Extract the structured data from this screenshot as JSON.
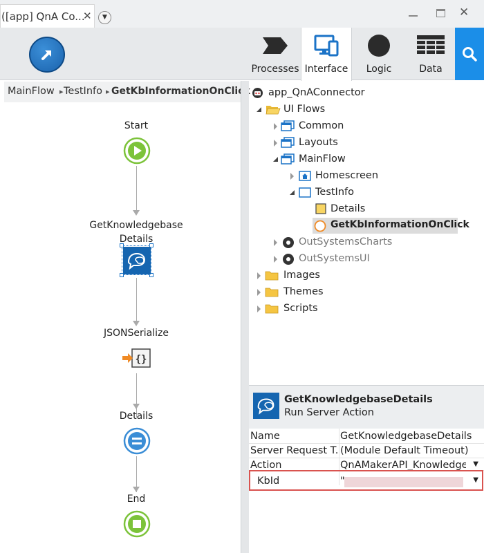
{
  "window": {
    "tab_title": "([app] QnA Co...",
    "tab_close": "✕",
    "dropdown_glyph": "▼",
    "close_glyph": "✕"
  },
  "toolbar": {
    "items": [
      {
        "label": "Processes",
        "icon": "processes-icon"
      },
      {
        "label": "Interface",
        "icon": "interface-icon",
        "active": true
      },
      {
        "label": "Logic",
        "icon": "logic-icon"
      },
      {
        "label": "Data",
        "icon": "data-icon"
      }
    ],
    "search_icon": "search-icon"
  },
  "breadcrumb": {
    "items": [
      "MainFlow",
      "TestInfo",
      "GetKbInformationOnClick"
    ],
    "separator": "▸"
  },
  "flow": {
    "nodes": [
      {
        "label": "Start",
        "type": "start"
      },
      {
        "label": "GetKnowledgebase Details",
        "type": "server-action",
        "line1": "GetKnowledgebase",
        "line2": "Details"
      },
      {
        "label": "JSONSerialize",
        "type": "json-serialize"
      },
      {
        "label": "Details",
        "type": "assign"
      },
      {
        "label": "End",
        "type": "end"
      }
    ]
  },
  "tree": {
    "root": "app_QnAConnector",
    "items": [
      {
        "label": "UI Flows"
      },
      {
        "label": "Common"
      },
      {
        "label": "Layouts"
      },
      {
        "label": "MainFlow"
      },
      {
        "label": "Homescreen"
      },
      {
        "label": "TestInfo"
      },
      {
        "label": "Details"
      },
      {
        "label": "GetKbInformationOnClick",
        "selected": true
      },
      {
        "label": "OutSystemsCharts"
      },
      {
        "label": "OutSystemsUI"
      },
      {
        "label": "Images"
      },
      {
        "label": "Themes"
      },
      {
        "label": "Scripts"
      }
    ]
  },
  "properties": {
    "title": "GetKnowledgebaseDetails",
    "subtitle": "Run Server Action",
    "rows": [
      {
        "key": "Name",
        "value": "GetKnowledgebaseDetails"
      },
      {
        "key": "Server Request T...",
        "value": "(Module Default Timeout)"
      },
      {
        "key": "Action",
        "value": "QnAMakerAPI_Knowledget"
      },
      {
        "key": "KbId",
        "value": "\""
      }
    ]
  },
  "colors": {
    "accent": "#1b8ee8",
    "start_green": "#7cc33a",
    "server_action_blue": "#1565b0",
    "highlight_red": "#d9534f",
    "folder_yellow": "#f5c542"
  }
}
